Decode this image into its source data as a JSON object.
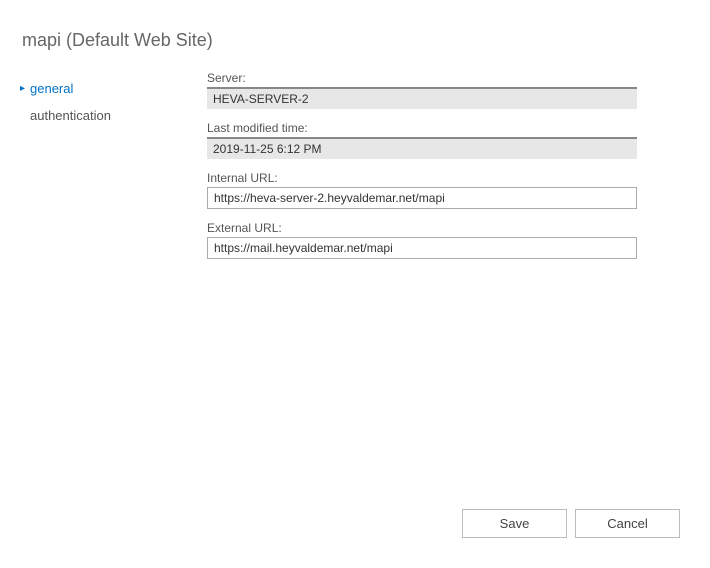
{
  "page": {
    "title": "mapi (Default Web Site)"
  },
  "sidebar": {
    "items": [
      {
        "label": "general",
        "active": true
      },
      {
        "label": "authentication",
        "active": false
      }
    ]
  },
  "fields": {
    "server": {
      "label": "Server:",
      "value": "HEVA-SERVER-2"
    },
    "lastModified": {
      "label": "Last modified time:",
      "value": "2019-11-25 6:12 PM"
    },
    "internalUrl": {
      "label": "Internal URL:",
      "value": "https://heva-server-2.heyvaldemar.net/mapi"
    },
    "externalUrl": {
      "label": "External URL:",
      "value": "https://mail.heyvaldemar.net/mapi"
    }
  },
  "buttons": {
    "save": "Save",
    "cancel": "Cancel"
  }
}
